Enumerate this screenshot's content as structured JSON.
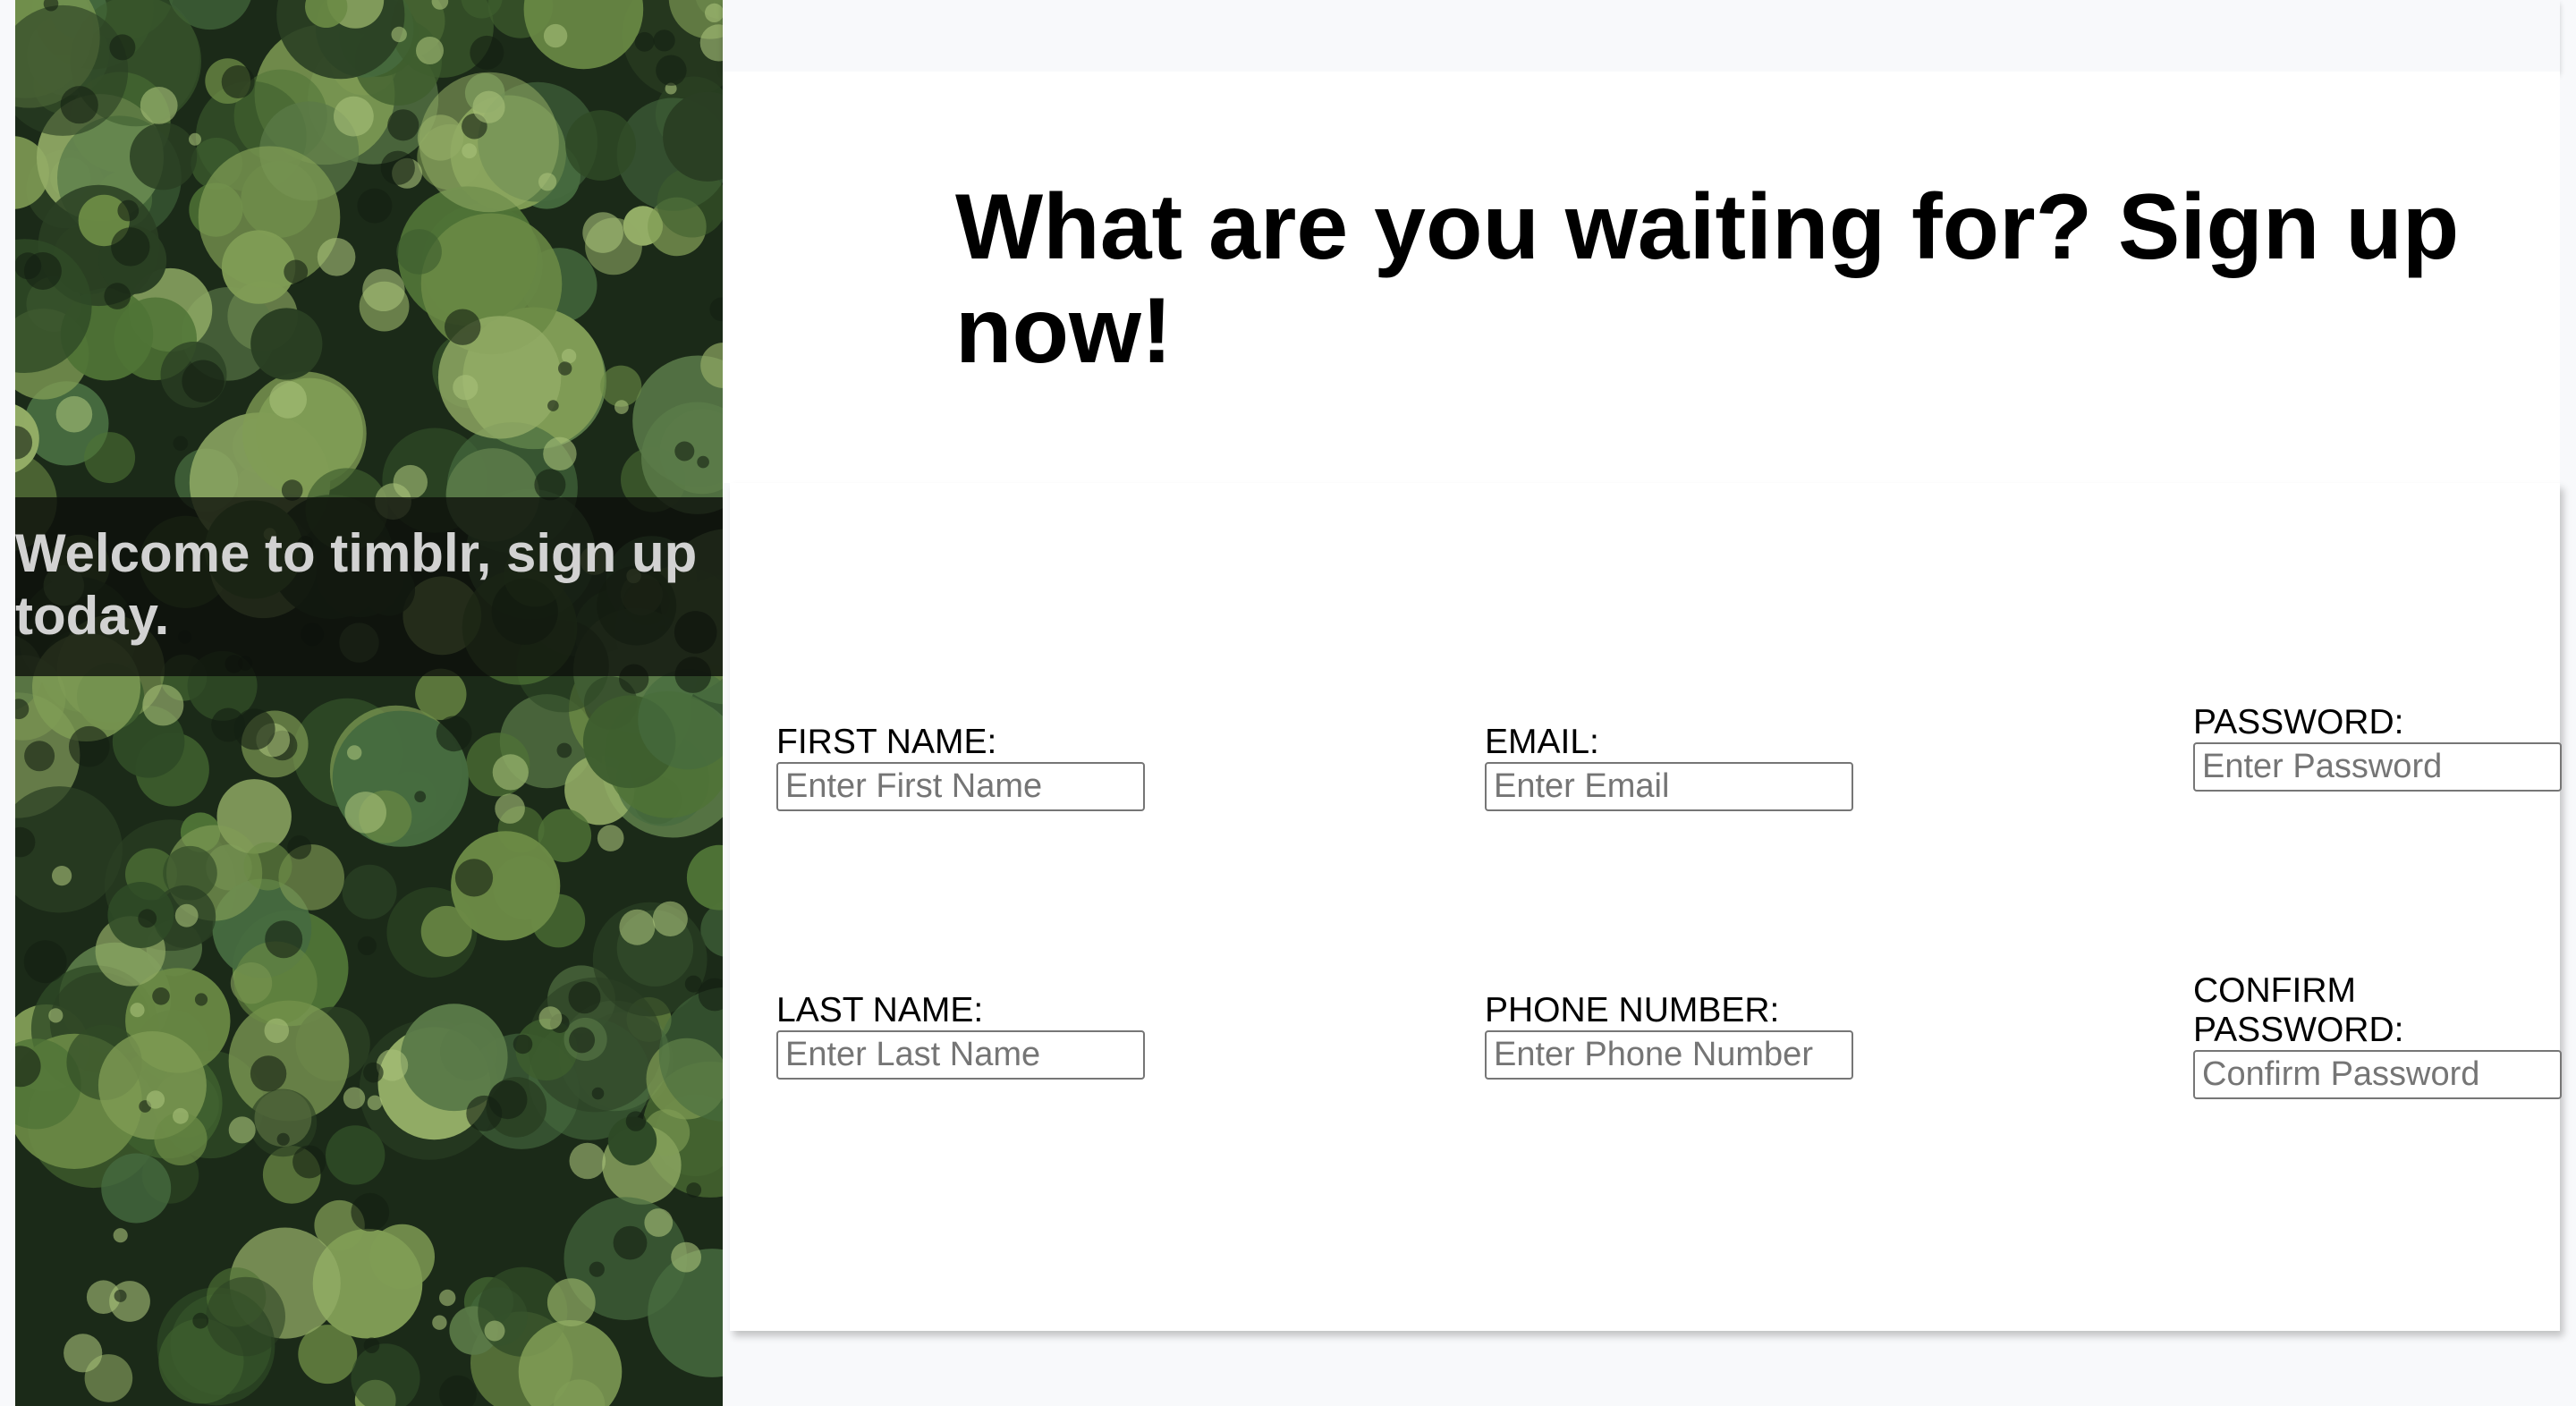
{
  "hero": {
    "welcome_text": "Welcome to timblr, sign up today."
  },
  "main": {
    "headline": "What are you waiting for? Sign up now!"
  },
  "form": {
    "first_name": {
      "label": "FIRST NAME:",
      "placeholder": "Enter First Name"
    },
    "last_name": {
      "label": "LAST NAME:",
      "placeholder": "Enter Last Name"
    },
    "email": {
      "label": "EMAIL:",
      "placeholder": "Enter Email"
    },
    "phone": {
      "label": "PHONE NUMBER:",
      "placeholder": "Enter Phone Number"
    },
    "password": {
      "label": "PASSWORD:",
      "placeholder": "Enter Password"
    },
    "confirm_password": {
      "label": "CONFIRM PASSWORD:",
      "placeholder": "Confirm Password"
    }
  },
  "colors": {
    "page_background": "#f8f9fb",
    "card_background": "#ffffff",
    "hero_overlay": "#0c0e0a",
    "hero_text": "#d2d2d2",
    "text": "#000000"
  }
}
